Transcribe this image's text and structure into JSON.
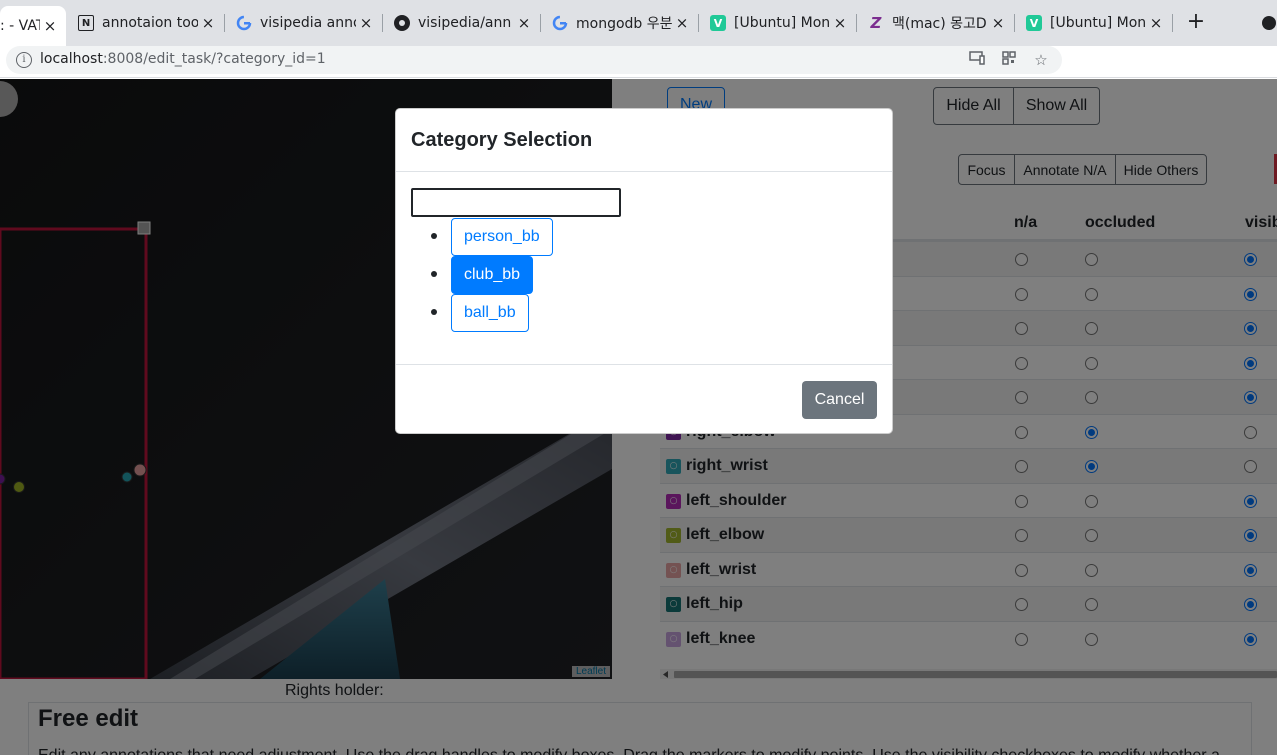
{
  "browser": {
    "tabs": [
      {
        "title": ": - VAT",
        "icon": "vat-favicon-icon",
        "active": true
      },
      {
        "title": "annotaion too",
        "icon": "notion-icon",
        "active": false
      },
      {
        "title": "visipedia anno",
        "icon": "google-icon",
        "active": false
      },
      {
        "title": "visipedia/ann",
        "icon": "github-icon",
        "active": false
      },
      {
        "title": "mongodb 우분",
        "icon": "google-icon",
        "active": false
      },
      {
        "title": "[Ubuntu] Mon",
        "icon": "velog-icon",
        "active": false
      },
      {
        "title": "맥(mac) 몽고D",
        "icon": "zerobase-icon",
        "active": false
      },
      {
        "title": "[Ubuntu] Mon",
        "icon": "velog-icon",
        "active": false
      }
    ],
    "tab_close": "×",
    "new_tab": "+",
    "url_host": "localhost",
    "url_rest": ":8008/edit_task/?category_id=1"
  },
  "toolbar": {
    "new_label": "New",
    "hide_all_label": "Hide All",
    "show_all_label": "Show All",
    "focus_label": "Focus",
    "annotate_na_label": "Annotate N/A",
    "hide_others_label": "Hide Others"
  },
  "table": {
    "headers": {
      "na": "n/a",
      "occluded": "occluded",
      "visible": "visib"
    },
    "rows": [
      {
        "label": "",
        "color": "#a0a0a0",
        "state": "visible"
      },
      {
        "label": "",
        "color": "#a0a0a0",
        "state": "visible"
      },
      {
        "label": "",
        "color": "#a0a0a0",
        "state": "visible"
      },
      {
        "label": "",
        "color": "#a0a0a0",
        "state": "visible"
      },
      {
        "label": "",
        "color": "#a0a0a0",
        "state": "visible"
      },
      {
        "label": "right_elbow",
        "color": "#7a1fa2",
        "state": "occluded"
      },
      {
        "label": "right_wrist",
        "color": "#26a6b5",
        "state": "occluded"
      },
      {
        "label": "left_shoulder",
        "color": "#b01fb5",
        "state": "visible"
      },
      {
        "label": "left_elbow",
        "color": "#9fb324",
        "state": "visible"
      },
      {
        "label": "left_wrist",
        "color": "#e8a0a0",
        "state": "visible"
      },
      {
        "label": "left_hip",
        "color": "#0b6e6e",
        "state": "visible"
      },
      {
        "label": "left_knee",
        "color": "#c7a0e0",
        "state": "visible"
      }
    ]
  },
  "map": {
    "attribution": "Leaflet"
  },
  "rights_holder_label": "Rights holder:",
  "free_edit": {
    "title": "Free edit",
    "text": "Edit any annotations that need adjustment. Use the drag handles to modify boxes. Drag the markers to modify points. Use the visibility checkboxes to modify whether a"
  },
  "modal": {
    "title": "Category Selection",
    "search_value": "",
    "categories": [
      {
        "label": "person_bb",
        "active": false
      },
      {
        "label": "club_bb",
        "active": true
      },
      {
        "label": "ball_bb",
        "active": false
      }
    ],
    "cancel_label": "Cancel"
  },
  "colors": {
    "primary": "#007bff",
    "secondary": "#6c757d",
    "bbox": "#c0143c"
  }
}
